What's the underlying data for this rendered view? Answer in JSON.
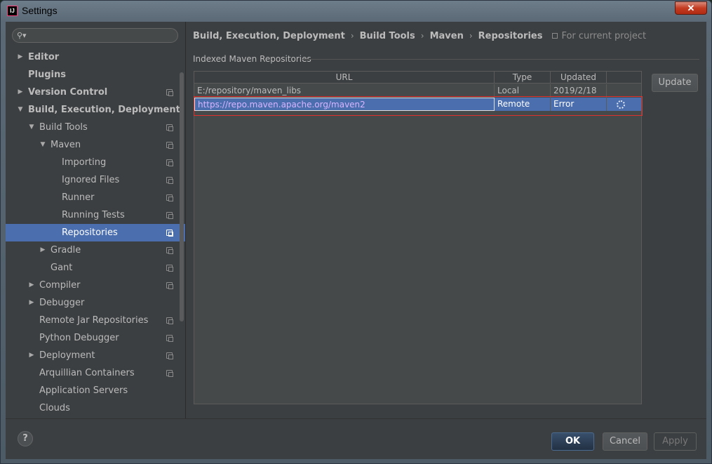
{
  "window": {
    "title": "Settings",
    "app_icon_text": "IJ",
    "close_glyph": "✕"
  },
  "search": {
    "placeholder": "",
    "icon": "search-icon"
  },
  "sidebar": {
    "items": [
      {
        "label": "Editor",
        "bold": true,
        "arrow": "▶",
        "indent": 0,
        "project": false
      },
      {
        "label": "Plugins",
        "bold": true,
        "arrow": "",
        "indent": 0,
        "project": false
      },
      {
        "label": "Version Control",
        "bold": true,
        "arrow": "▶",
        "indent": 0,
        "project": true
      },
      {
        "label": "Build, Execution, Deployment",
        "bold": true,
        "arrow": "▼",
        "indent": 0,
        "project": false
      },
      {
        "label": "Build Tools",
        "bold": false,
        "arrow": "▼",
        "indent": 1,
        "project": true
      },
      {
        "label": "Maven",
        "bold": false,
        "arrow": "▼",
        "indent": 2,
        "project": true
      },
      {
        "label": "Importing",
        "bold": false,
        "arrow": "",
        "indent": 3,
        "project": true
      },
      {
        "label": "Ignored Files",
        "bold": false,
        "arrow": "",
        "indent": 3,
        "project": true
      },
      {
        "label": "Runner",
        "bold": false,
        "arrow": "",
        "indent": 3,
        "project": true
      },
      {
        "label": "Running Tests",
        "bold": false,
        "arrow": "",
        "indent": 3,
        "project": true
      },
      {
        "label": "Repositories",
        "bold": false,
        "arrow": "",
        "indent": 3,
        "project": true,
        "selected": true
      },
      {
        "label": "Gradle",
        "bold": false,
        "arrow": "▶",
        "indent": 2,
        "project": true
      },
      {
        "label": "Gant",
        "bold": false,
        "arrow": "",
        "indent": 2,
        "project": true
      },
      {
        "label": "Compiler",
        "bold": false,
        "arrow": "▶",
        "indent": 1,
        "project": true
      },
      {
        "label": "Debugger",
        "bold": false,
        "arrow": "▶",
        "indent": 1,
        "project": false
      },
      {
        "label": "Remote Jar Repositories",
        "bold": false,
        "arrow": "",
        "indent": 1,
        "project": true
      },
      {
        "label": "Python Debugger",
        "bold": false,
        "arrow": "",
        "indent": 1,
        "project": true
      },
      {
        "label": "Deployment",
        "bold": false,
        "arrow": "▶",
        "indent": 1,
        "project": true
      },
      {
        "label": "Arquillian Containers",
        "bold": false,
        "arrow": "",
        "indent": 1,
        "project": true
      },
      {
        "label": "Application Servers",
        "bold": false,
        "arrow": "",
        "indent": 1,
        "project": false
      },
      {
        "label": "Clouds",
        "bold": false,
        "arrow": "",
        "indent": 1,
        "project": false
      }
    ]
  },
  "breadcrumb": {
    "items": [
      "Build, Execution, Deployment",
      "Build Tools",
      "Maven",
      "Repositories"
    ],
    "separator": "›",
    "scope": "For current project"
  },
  "repositories": {
    "group_title": "Indexed Maven Repositories",
    "columns": [
      "URL",
      "Type",
      "Updated"
    ],
    "rows": [
      {
        "url": "E:/repository/maven_libs",
        "type": "Local",
        "updated": "2019/2/18",
        "selected": false
      },
      {
        "url": "https://repo.maven.apache.org/maven2",
        "type": "Remote",
        "updated": "Error",
        "selected": true
      }
    ],
    "update_label": "Update"
  },
  "footer": {
    "help_label": "?",
    "ok_label": "OK",
    "cancel_label": "Cancel",
    "apply_label": "Apply"
  },
  "colors": {
    "selection": "#4b6eaf",
    "highlight_box": "#e0302e",
    "background": "#3c3f41"
  }
}
